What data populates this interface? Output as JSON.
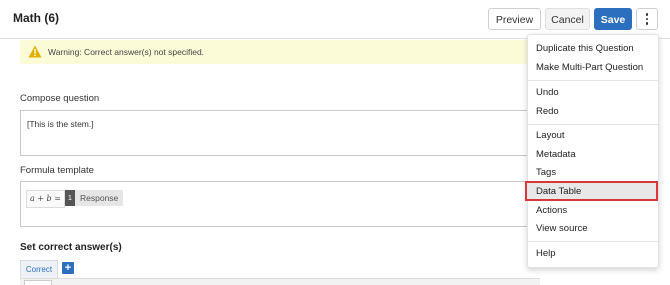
{
  "header": {
    "title": "Math (6)",
    "preview_label": "Preview",
    "cancel_label": "Cancel",
    "save_label": "Save",
    "more_icon": "kebab-vertical-icon"
  },
  "warning": {
    "icon": "warning-triangle-icon",
    "text": "Warning: Correct answer(s) not specified.",
    "background": "#fcfbd8",
    "icon_color": "#e0b000"
  },
  "compose": {
    "label": "Compose question",
    "value": "[This is the stem.]"
  },
  "formula": {
    "label": "Formula template",
    "math": "a + b =",
    "response_number": "1",
    "response_label": "Response"
  },
  "answer": {
    "heading": "Set correct answer(s)",
    "tab_label": "Correct",
    "add_icon": "plus-icon"
  },
  "menu": {
    "group1": [
      "Duplicate this Question",
      "Make Multi-Part Question"
    ],
    "group2": [
      "Undo",
      "Redo"
    ],
    "group3": [
      "Layout",
      "Metadata",
      "Tags",
      "Data Table",
      "Actions",
      "View source"
    ],
    "group4": [
      "Help"
    ],
    "highlighted_item": "Data Table",
    "highlight_border": "#d93838"
  },
  "colors": {
    "accent": "#2c6fbf"
  }
}
